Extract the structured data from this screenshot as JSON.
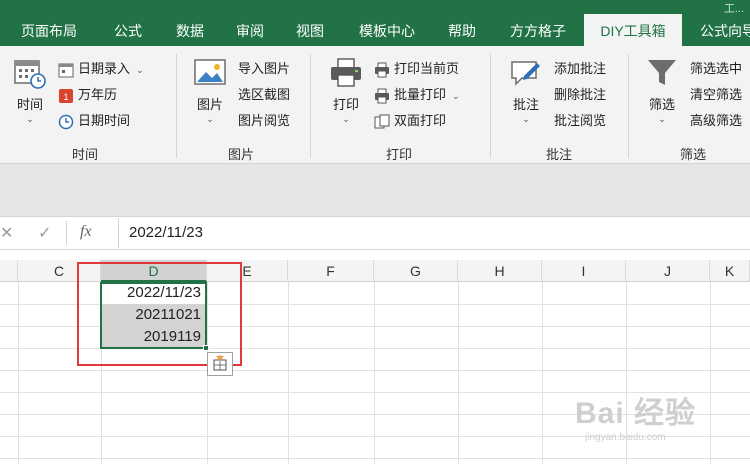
{
  "topright_text": "工...",
  "tabs": [
    {
      "label": "页面布局",
      "active": false
    },
    {
      "label": "公式",
      "active": false
    },
    {
      "label": "数据",
      "active": false
    },
    {
      "label": "审阅",
      "active": false
    },
    {
      "label": "视图",
      "active": false
    },
    {
      "label": "模板中心",
      "active": false
    },
    {
      "label": "帮助",
      "active": false
    },
    {
      "label": "方方格子",
      "active": false
    },
    {
      "label": "DIY工具箱",
      "active": true
    },
    {
      "label": "公式向导",
      "active": false
    }
  ],
  "ribbon": {
    "time_group": {
      "label": "时间",
      "big_label": "时间",
      "items": [
        "日期录入",
        "万年历",
        "日期时间"
      ]
    },
    "picture_group": {
      "label": "图片",
      "big_label": "图片",
      "items": [
        "导入图片",
        "选区截图",
        "图片阅览"
      ]
    },
    "print_group": {
      "label": "打印",
      "big_label": "打印",
      "items": [
        "打印当前页",
        "批量打印",
        "双面打印"
      ]
    },
    "comment_group": {
      "label": "批注",
      "big_label": "批注",
      "items": [
        "添加批注",
        "删除批注",
        "批注阅览"
      ]
    },
    "filter_group": {
      "label": "筛选",
      "big_label": "筛选",
      "items": [
        "筛选选中",
        "清空筛选",
        "高级筛选"
      ]
    }
  },
  "formula_bar": {
    "cancel": "✕",
    "confirm": "✓",
    "fx": "fx",
    "value": "2022/11/23"
  },
  "columns": [
    "C",
    "D",
    "E",
    "F",
    "G",
    "H",
    "I",
    "J",
    "K"
  ],
  "cells": {
    "d1": "2022/11/23",
    "d2": "20211021",
    "d3": "2019119"
  },
  "watermark": {
    "brand": "Bai 经验",
    "url": "jingyan.baidu.com"
  },
  "colors": {
    "accent": "#217346",
    "highlight_box": "#e0393b"
  }
}
